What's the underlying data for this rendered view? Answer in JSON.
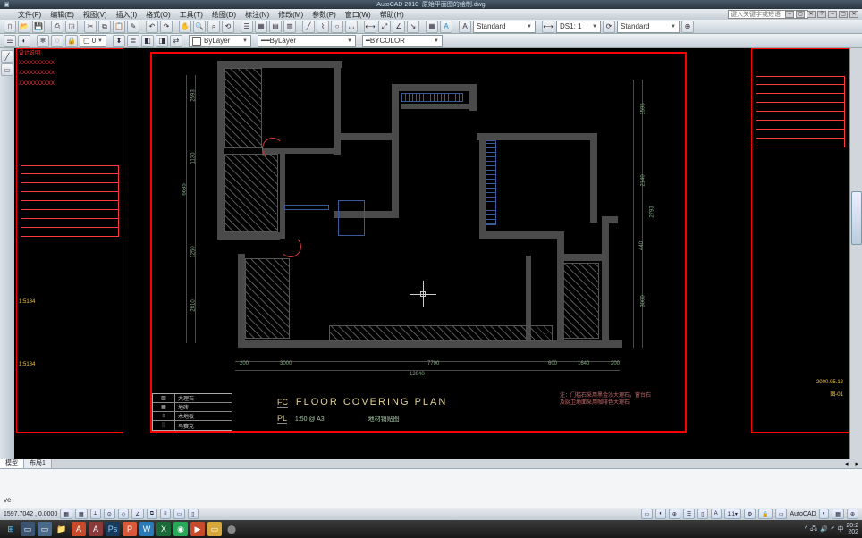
{
  "app": {
    "name": "AutoCAD 2010",
    "doc": "原始平面图的绘制.dwg"
  },
  "help_placeholder": "键入关键字或短语",
  "menu": [
    "文件(F)",
    "编辑(E)",
    "视图(V)",
    "插入(I)",
    "格式(O)",
    "工具(T)",
    "绘图(D)",
    "标注(N)",
    "修改(M)",
    "参数(P)",
    "窗口(W)",
    "帮助(H)"
  ],
  "layers": {
    "current": "ByLayer",
    "color": "ByLayer",
    "linetype": "BYCOLOR"
  },
  "text_style": {
    "label": "Standard",
    "txt": "A"
  },
  "dim_style": {
    "prefix": "DS1: 1",
    "list": "Standard"
  },
  "plan": {
    "fc": "FC",
    "pl": "PL",
    "title": "FLOOR  COVERING  PLAN",
    "scale": "1:50 @ A3",
    "subtitle": "地材铺贴图",
    "notes1": "注：门槛石采用黑金沙大理石，窗台石",
    "notes2": "及厨卫地面采用咖啡色大理石",
    "legend": [
      {
        "sym": "▨",
        "label": "大理石"
      },
      {
        "sym": "▦",
        "label": "地砖"
      },
      {
        "sym": "≡",
        "label": "木地板"
      },
      {
        "sym": "░",
        "label": "马赛克"
      }
    ],
    "dims_top": [
      "2593"
    ],
    "dims_left": [
      "6635",
      "1130",
      "1250",
      "2810"
    ],
    "dims_right": [
      "1595",
      "2140",
      "2793",
      "440",
      "3000"
    ],
    "dims_bottom": [
      "200",
      "3000",
      "7790",
      "600",
      "1640",
      "200"
    ],
    "dims_total": "12940"
  },
  "side_text_l": [
    "设计说明",
    "XXXXXXXXXX",
    "XXXXXXXXXX",
    "XXXXXXXXXX"
  ],
  "side_label_l1": "1:5184",
  "side_label_l2": "1:5184",
  "side_label_r1": "2000.05.12",
  "side_label_r2": "图-01",
  "tabs": {
    "model": "模型",
    "layout": "布局1"
  },
  "cmd_history": "ve",
  "coords": "1597.7042 , 0.0000",
  "status_right": [
    "AutoCAD",
    "◐",
    "▦",
    "⊕"
  ],
  "taskbar": {
    "icons": [
      {
        "bg": "#2a80d8",
        "g": "⊞"
      },
      {
        "bg": "#3b5570",
        "g": "▭"
      },
      {
        "bg": "#4a6a8a",
        "g": "▭"
      },
      {
        "bg": "#f5c242",
        "g": "📁"
      },
      {
        "bg": "#c74a2a",
        "g": "A"
      },
      {
        "bg": "#8a3a3a",
        "g": "A"
      },
      {
        "bg": "#d85a3a",
        "g": "Ps"
      },
      {
        "bg": "#d85a3a",
        "g": "P"
      },
      {
        "bg": "#2a7ab8",
        "g": "W"
      },
      {
        "bg": "#1a6a3a",
        "g": "X"
      },
      {
        "bg": "#2aa85a",
        "g": "◉"
      },
      {
        "bg": "#c74a2a",
        "g": "▶"
      },
      {
        "bg": "#d8a83a",
        "g": "▭"
      },
      {
        "bg": "#444",
        "g": "⬤"
      }
    ],
    "time": "20:2",
    "date": "202"
  }
}
